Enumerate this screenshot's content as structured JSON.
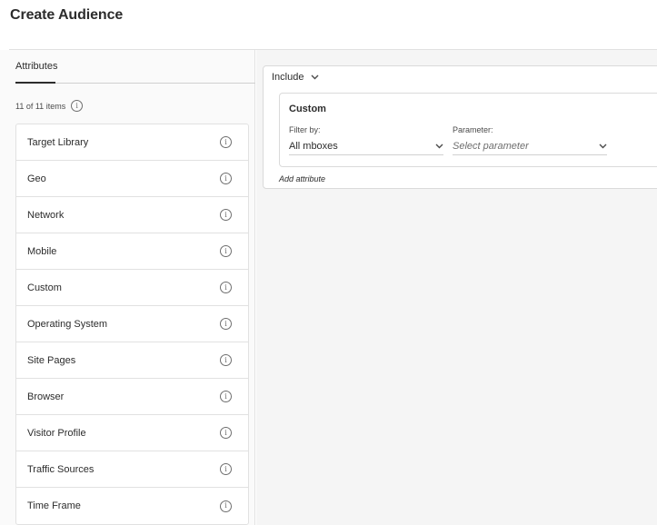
{
  "header": {
    "title": "Create Audience"
  },
  "left_panel": {
    "tab_label": "Attributes",
    "count_text": "11 of 11 items",
    "items": [
      {
        "label": "Target Library"
      },
      {
        "label": "Geo"
      },
      {
        "label": "Network"
      },
      {
        "label": "Mobile"
      },
      {
        "label": "Custom"
      },
      {
        "label": "Operating System"
      },
      {
        "label": "Site Pages"
      },
      {
        "label": "Browser"
      },
      {
        "label": "Visitor Profile"
      },
      {
        "label": "Traffic Sources"
      },
      {
        "label": "Time Frame"
      }
    ]
  },
  "rule": {
    "include_label": "Include",
    "custom_title": "Custom",
    "filter_by_label": "Filter by:",
    "filter_by_value": "All mboxes",
    "parameter_label": "Parameter:",
    "parameter_placeholder": "Select parameter",
    "add_attribute": "Add attribute"
  },
  "icons": {
    "info": "info-icon",
    "chevron": "chevron-down-icon"
  }
}
